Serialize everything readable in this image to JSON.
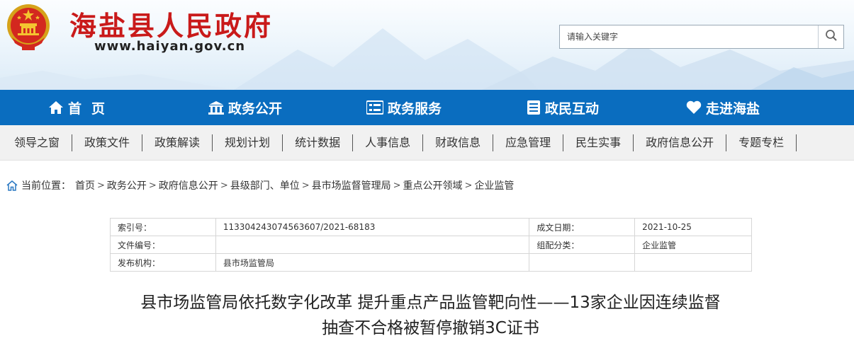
{
  "header": {
    "site_title": "海盐县人民政府",
    "site_domain": "www.haiyan.gov.cn",
    "emblem_icon": "national-emblem-icon",
    "search": {
      "placeholder": "请输入关键字",
      "icon": "search-icon"
    }
  },
  "main_nav": [
    {
      "label": "首页",
      "icon": "home-icon"
    },
    {
      "label": "政务公开",
      "icon": "building-icon"
    },
    {
      "label": "政务服务",
      "icon": "list-icon"
    },
    {
      "label": "政民互动",
      "icon": "document-icon"
    },
    {
      "label": "走进海盐",
      "icon": "heart-icon"
    }
  ],
  "sub_nav": [
    "领导之窗",
    "政策文件",
    "政策解读",
    "规划计划",
    "统计数据",
    "人事信息",
    "财政信息",
    "应急管理",
    "民生实事",
    "政府信息公开",
    "专题专栏"
  ],
  "breadcrumb": {
    "prefix": "当前位置：",
    "icon": "home-outline-icon",
    "separator": ">",
    "items": [
      "首页",
      "政务公开",
      "政府信息公开",
      "县级部门、单位",
      "县市场监督管理局",
      "重点公开领域",
      "企业监管"
    ]
  },
  "info_table": {
    "rows": [
      {
        "k1": "索引号：",
        "v1": "113304243074563607/2021-68183",
        "k2": "成文日期：",
        "v2": "2021-10-25"
      },
      {
        "k1": "文件编号：",
        "v1": "",
        "k2": "组配分类：",
        "v2": "企业监管"
      },
      {
        "k1": "发布机构：",
        "v1": "县市场监管局",
        "k2": "",
        "v2": ""
      }
    ]
  },
  "article": {
    "title_line1": "县市场监管局依托数字化改革 提升重点产品监管靶向性——13家企业因连续监督",
    "title_line2": "抽查不合格被暂停撤销3C证书"
  },
  "colors": {
    "nav_blue": "#0a6dbf",
    "title_red": "#c91a1a",
    "subnav_bg": "#f1f1f1"
  }
}
